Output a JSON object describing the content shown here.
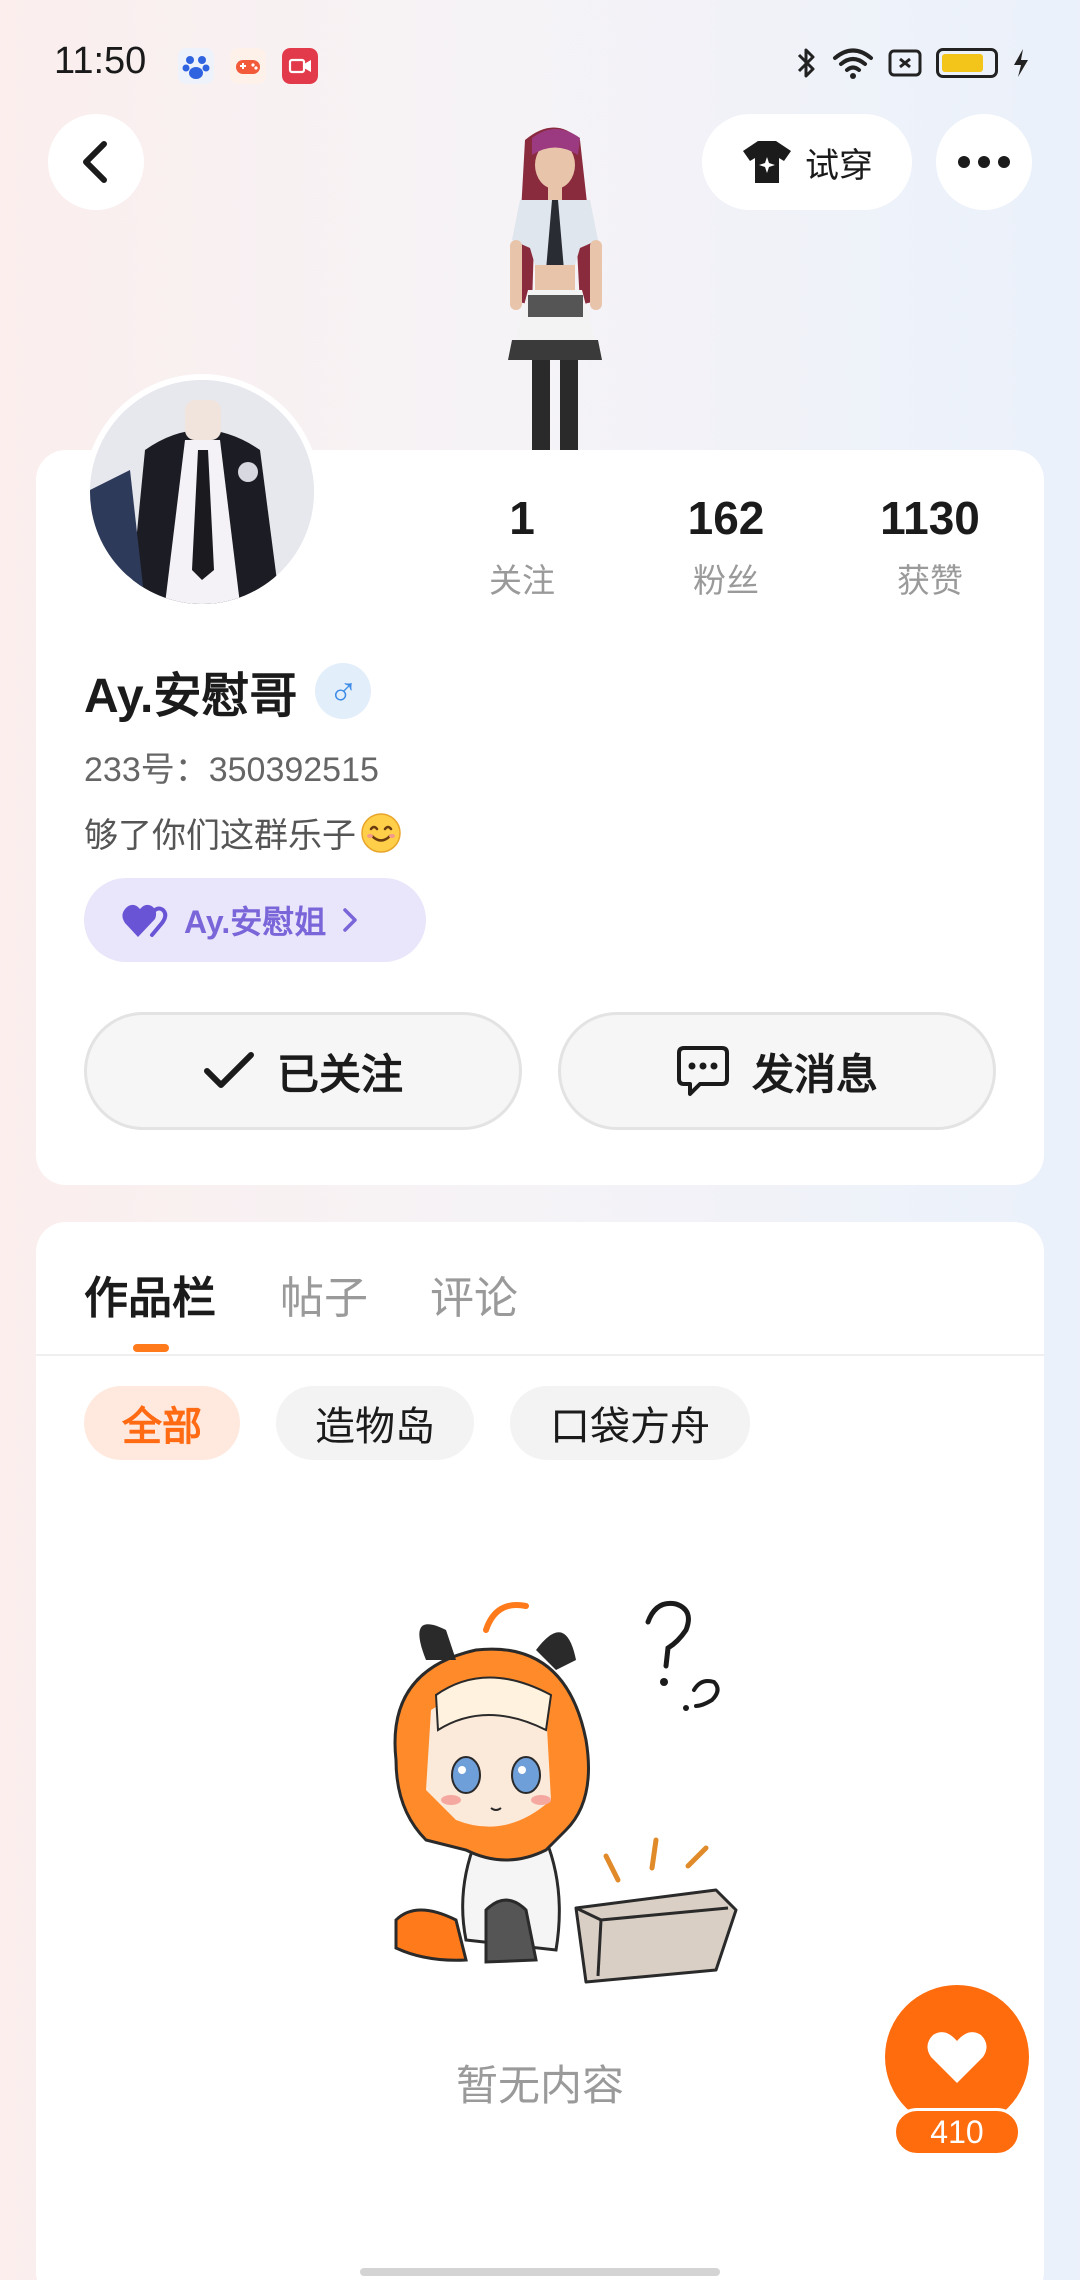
{
  "status_bar": {
    "time": "11:50",
    "battery_color": "#f3c51b",
    "icons": [
      "baidu-app-icon",
      "game-app-icon",
      "video-app-icon",
      "bluetooth-icon",
      "wifi-icon",
      "sim-icon",
      "battery-icon",
      "charging-icon"
    ]
  },
  "header": {
    "try_on_label": "试穿"
  },
  "profile": {
    "stats": [
      {
        "value": "1",
        "label": "关注"
      },
      {
        "value": "162",
        "label": "粉丝"
      },
      {
        "value": "1130",
        "label": "获赞"
      }
    ],
    "name": "Ay.安慰哥",
    "gender_symbol": "♂",
    "id_text": "233号：350392515",
    "bio": "够了你们这群乐子",
    "partner_name": "Ay.安慰姐",
    "follow_label": "已关注",
    "message_label": "发消息"
  },
  "works": {
    "tabs": [
      "作品栏",
      "帖子",
      "评论"
    ],
    "active_tab": "作品栏",
    "filters": [
      "全部",
      "造物岛",
      "口袋方舟"
    ],
    "active_filter": "全部",
    "empty_text": "暂无内容"
  },
  "like": {
    "count": "410"
  },
  "colors": {
    "accent": "#ff6c0e",
    "partner": "#7b66d9",
    "gender": "#3d8be6"
  }
}
